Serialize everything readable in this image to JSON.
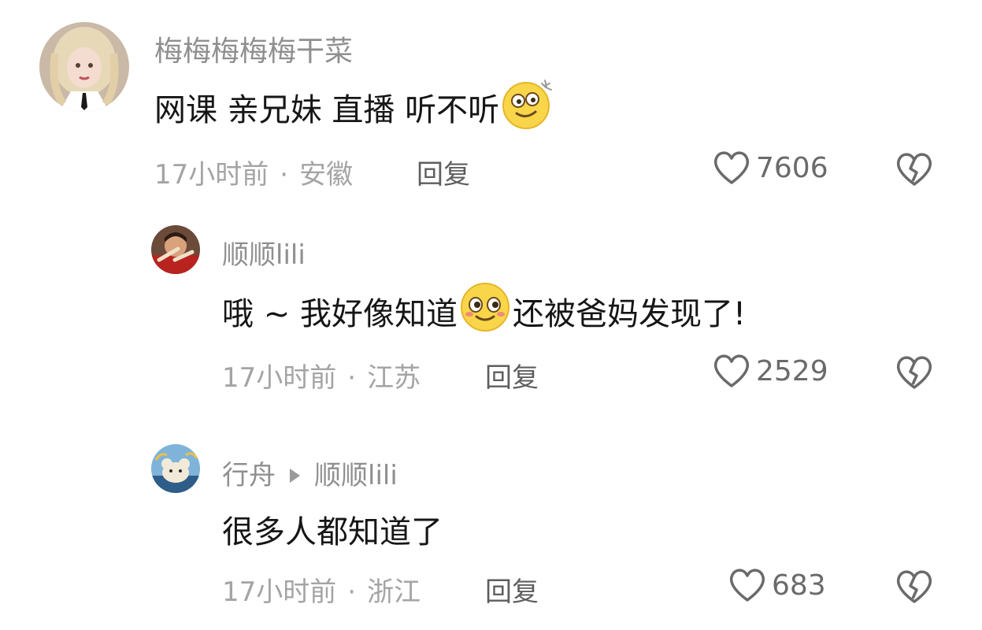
{
  "comments": [
    {
      "username": "梅梅梅梅梅干菜",
      "content_parts": [
        "网课 亲兄妹 直播 听不听"
      ],
      "emoji": "dizzy-smile-emoji",
      "time": "17小时前",
      "separator": "·",
      "location": "安徽",
      "reply_label": "回复",
      "likes": "7606"
    },
    {
      "username": "顺顺lili",
      "content_parts": [
        "哦 ~ 我好像知道",
        "还被爸妈发现了!"
      ],
      "emoji": "wink-smile-emoji",
      "time": "17小时前",
      "separator": "·",
      "location": "江苏",
      "reply_label": "回复",
      "likes": "2529"
    },
    {
      "username": "行舟",
      "reply_to": "顺顺lili",
      "content_parts": [
        "很多人都知道了"
      ],
      "time": "17小时前",
      "separator": "·",
      "location": "浙江",
      "reply_label": "回复",
      "likes": "683"
    }
  ],
  "colors": {
    "username": "#8f8f8f",
    "content": "#161616",
    "meta": "#a4a4a4",
    "reply": "#5e5e5e",
    "icon": "#6a6a6a"
  }
}
